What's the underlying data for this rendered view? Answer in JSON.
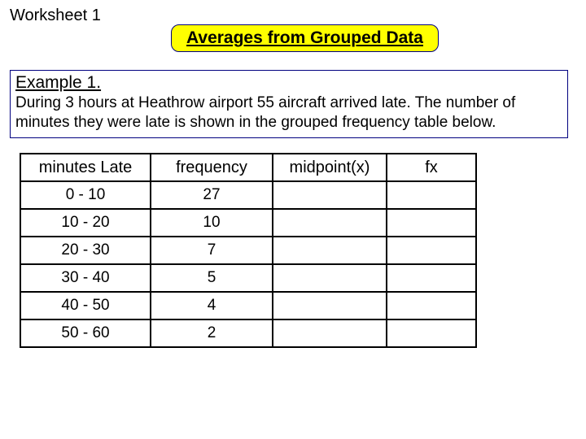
{
  "worksheet_label": "Worksheet 1",
  "title": "Averages from Grouped Data",
  "example": {
    "heading": "Example 1.",
    "text": "During 3 hours at Heathrow airport 55 aircraft arrived late.  The number of minutes they were late is shown in the grouped frequency table below."
  },
  "table": {
    "headers": [
      "minutes Late",
      "frequency",
      "midpoint(x)",
      "fx"
    ],
    "rows": [
      {
        "range": "0 - 10",
        "frequency": "27",
        "midpoint": "",
        "fx": ""
      },
      {
        "range": "10 - 20",
        "frequency": "10",
        "midpoint": "",
        "fx": ""
      },
      {
        "range": "20 - 30",
        "frequency": "7",
        "midpoint": "",
        "fx": ""
      },
      {
        "range": "30 - 40",
        "frequency": "5",
        "midpoint": "",
        "fx": ""
      },
      {
        "range": "40 - 50",
        "frequency": "4",
        "midpoint": "",
        "fx": ""
      },
      {
        "range": "50 - 60",
        "frequency": "2",
        "midpoint": "",
        "fx": ""
      }
    ]
  }
}
